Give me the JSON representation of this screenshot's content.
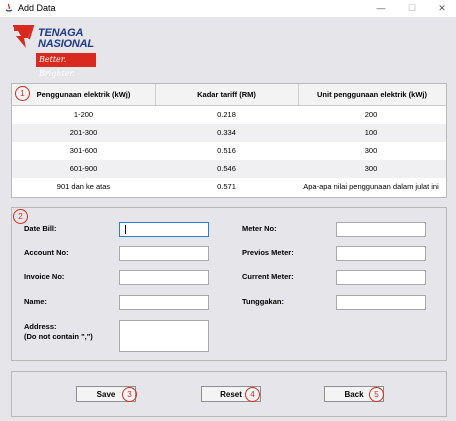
{
  "window": {
    "title": "Add Data",
    "minimize": "—",
    "maximize": "☐",
    "close": "✕"
  },
  "logo": {
    "line1": "TENAGA",
    "line2": "NASIONAL",
    "tagline": "Better. Brighter."
  },
  "colors": {
    "brand_red": "#d82a1f",
    "brand_blue": "#1f3a8a",
    "panel_bg": "#e6e6ea"
  },
  "badges": {
    "table": "1",
    "form": "2",
    "save": "3",
    "reset": "4",
    "back": "5"
  },
  "table": {
    "headers": [
      "Penggunaan elektrik (kWj)",
      "Kadar tariff (RM)",
      "Unit penggunaan elektrik (kWj)"
    ],
    "rows": [
      [
        "1-200",
        "0.218",
        "200"
      ],
      [
        "201-300",
        "0.334",
        "100"
      ],
      [
        "301-600",
        "0.516",
        "300"
      ],
      [
        "601-900",
        "0.546",
        "300"
      ],
      [
        "901 dan ke atas",
        "0.571",
        "Apa-apa nilai penggunaan dalam julat ini"
      ]
    ]
  },
  "form": {
    "date_bill": {
      "label": "Date Bill:",
      "value": ""
    },
    "account_no": {
      "label": "Account No:",
      "value": ""
    },
    "invoice_no": {
      "label": "Invoice No:",
      "value": ""
    },
    "name": {
      "label": "Name:",
      "value": ""
    },
    "address": {
      "label_line1": "Address:",
      "label_line2": "(Do not contain \",\")",
      "value": ""
    },
    "meter_no": {
      "label": "Meter No:",
      "value": ""
    },
    "previous_meter": {
      "label": "Previos Meter:",
      "value": ""
    },
    "current_meter": {
      "label": "Current Meter:",
      "value": ""
    },
    "tunggakan": {
      "label": "Tunggakan:",
      "value": ""
    }
  },
  "buttons": {
    "save": "Save",
    "reset": "Reset",
    "back": "Back"
  }
}
